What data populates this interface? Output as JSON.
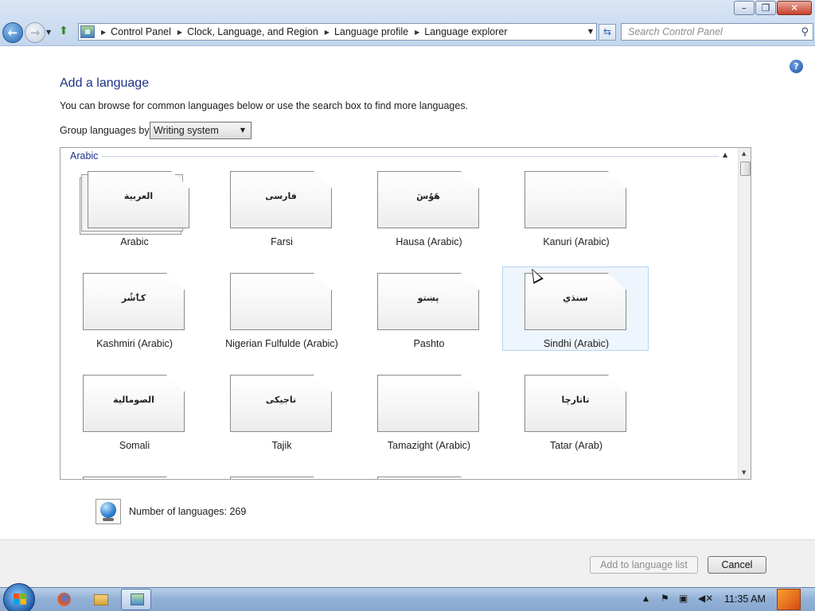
{
  "window": {
    "minimize_glyph": "–",
    "maximize_glyph": "❐",
    "close_glyph": "✕"
  },
  "address": {
    "breadcrumbs": [
      "Control Panel",
      "Clock, Language, and Region",
      "Language profile",
      "Language explorer"
    ],
    "search_placeholder": "Search Control Panel"
  },
  "content": {
    "title": "Add a language",
    "description": "You can browse for common languages below or use the search box to find more languages.",
    "group_by_label": "Group languages by:",
    "group_by_value": "Writing system",
    "group_name": "Arabic",
    "languages": [
      {
        "label": "Arabic",
        "sample": "العربية",
        "stacked": true
      },
      {
        "label": "Farsi",
        "sample": "فارسی"
      },
      {
        "label": "Hausa (Arabic)",
        "sample": "هَوُسَ"
      },
      {
        "label": "Kanuri (Arabic)",
        "sample": ""
      },
      {
        "label": "Kashmiri (Arabic)",
        "sample": "کٲشُر"
      },
      {
        "label": "Nigerian Fulfulde (Arabic)",
        "sample": ""
      },
      {
        "label": "Pashto",
        "sample": "پښتو"
      },
      {
        "label": "Sindhi (Arabic)",
        "sample": "سنڌي",
        "selected": true
      },
      {
        "label": "Somali",
        "sample": "الصومالية"
      },
      {
        "label": "Tajik",
        "sample": "تاجیکی"
      },
      {
        "label": "Tamazight (Arabic)",
        "sample": ""
      },
      {
        "label": "Tatar (Arab)",
        "sample": "تاتارچا"
      }
    ],
    "language_count": "Number of languages: 269"
  },
  "footer": {
    "add_label": "Add to language list",
    "cancel_label": "Cancel"
  },
  "taskbar": {
    "clock": "11:35 AM"
  },
  "colors": {
    "title_blue": "#1e3287",
    "selection": "#eef5fd"
  }
}
